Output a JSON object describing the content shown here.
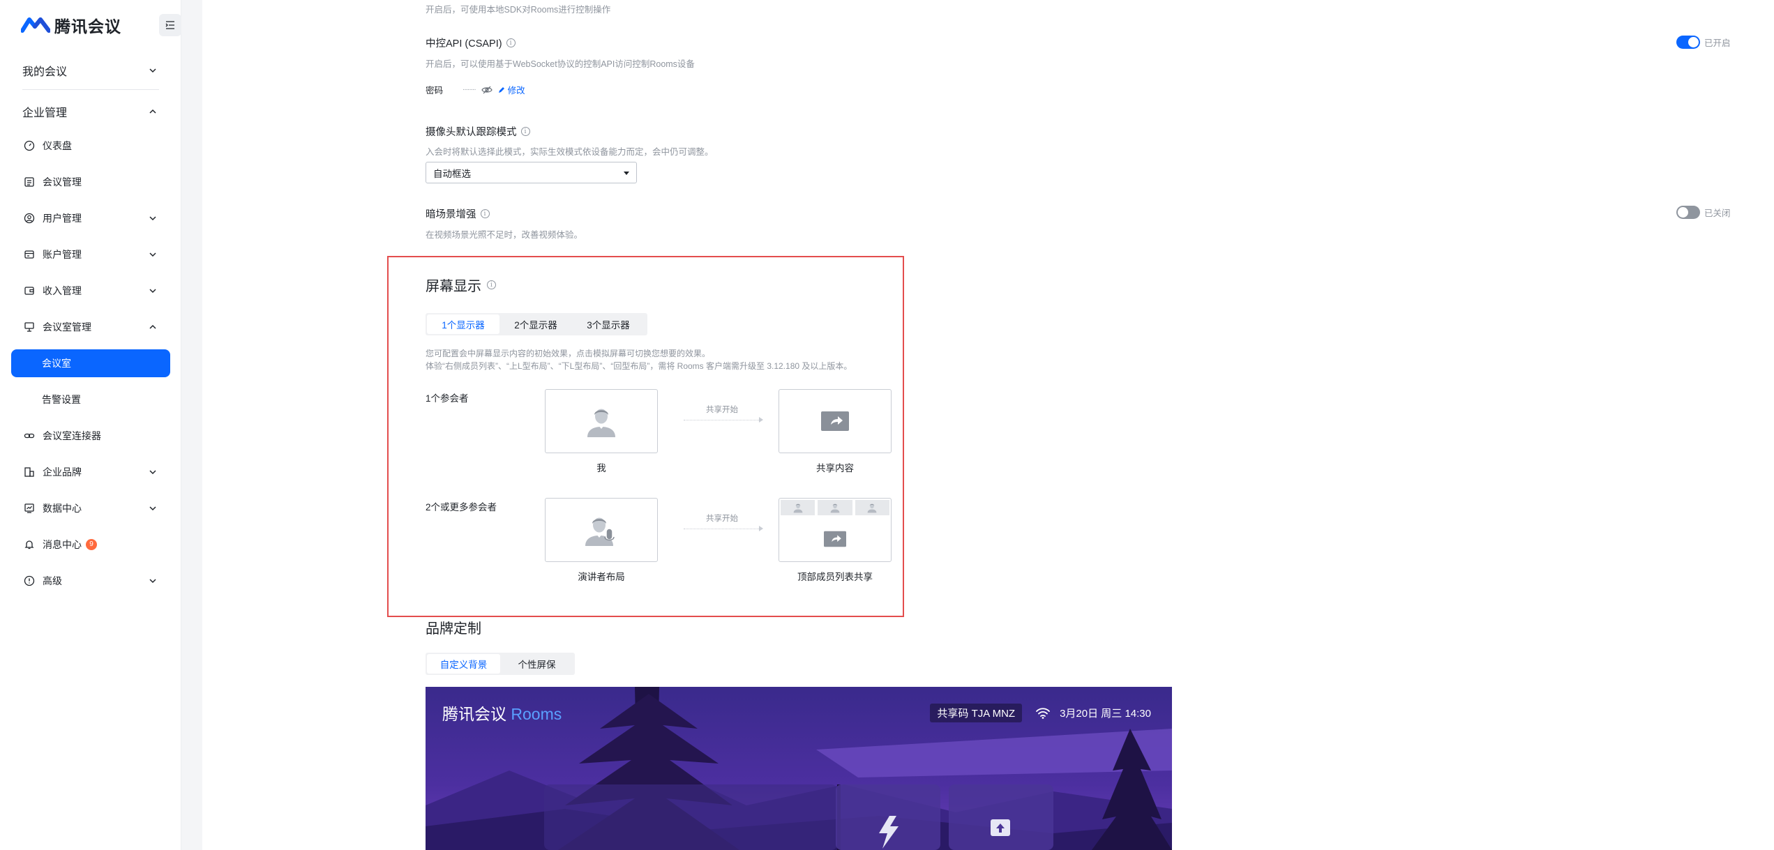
{
  "brand": {
    "name": "腾讯会议"
  },
  "sidebar": {
    "groups": [
      {
        "label": "我的会议"
      },
      {
        "label": "企业管理"
      }
    ],
    "items": [
      {
        "label": "仪表盘"
      },
      {
        "label": "会议管理"
      },
      {
        "label": "用户管理"
      },
      {
        "label": "账户管理"
      },
      {
        "label": "收入管理"
      },
      {
        "label": "会议室管理"
      },
      {
        "label": "会议室"
      },
      {
        "label": "告警设置"
      },
      {
        "label": "会议室连接器"
      },
      {
        "label": "企业品牌"
      },
      {
        "label": "数据中心"
      },
      {
        "label": "消息中心",
        "badge": "9"
      },
      {
        "label": "高级"
      }
    ]
  },
  "settings": {
    "top_desc": "开启后，可使用本地SDK对Rooms进行控制操作",
    "csapi": {
      "title": "中控API (CSAPI)",
      "desc": "开启后，可以使用基于WebSocket协议的控制API访问控制Rooms设备",
      "status": "已开启",
      "password_label": "密码",
      "password_value": "········",
      "edit_label": "修改"
    },
    "camera": {
      "title": "摄像头默认跟踪模式",
      "desc": "入会时将默认选择此模式，实际生效模式依设备能力而定，会中仍可调整。",
      "selected": "自动框选"
    },
    "lowlight": {
      "title": "暗场景增强",
      "desc": "在视频场景光照不足时，改善视频体验。",
      "status": "已关闭"
    }
  },
  "screen_display": {
    "title": "屏幕显示",
    "tabs": [
      "1个显示器",
      "2个显示器",
      "3个显示器"
    ],
    "desc1": "您可配置会中屏幕显示内容的初始效果，点击模拟屏幕可切换您想要的效果。",
    "desc2": "体验“右侧成员列表”、“上L型布局”、“下L型布局”、“回型布局”，需将 Rooms 客户端需升级至 3.12.180 及以上版本。",
    "row1_label": "1个参会者",
    "row2_label": "2个或更多参会者",
    "arrow_label": "共享开始",
    "row1_left_caption": "我",
    "row1_right_caption": "共享内容",
    "row2_left_caption": "演讲者布局",
    "row2_right_caption": "顶部成员列表共享"
  },
  "branding": {
    "title": "品牌定制",
    "tabs": [
      "自定义背景",
      "个性屏保"
    ],
    "preview": {
      "app_name": "腾讯会议",
      "app_suffix": "Rooms",
      "share_code": "共享码 TJA MNZ",
      "date": "3月20日 周三 14:30"
    }
  },
  "colors": {
    "accent": "#0a66ff",
    "highlight": "#e34d4d",
    "badge": "#ff6a3d"
  }
}
